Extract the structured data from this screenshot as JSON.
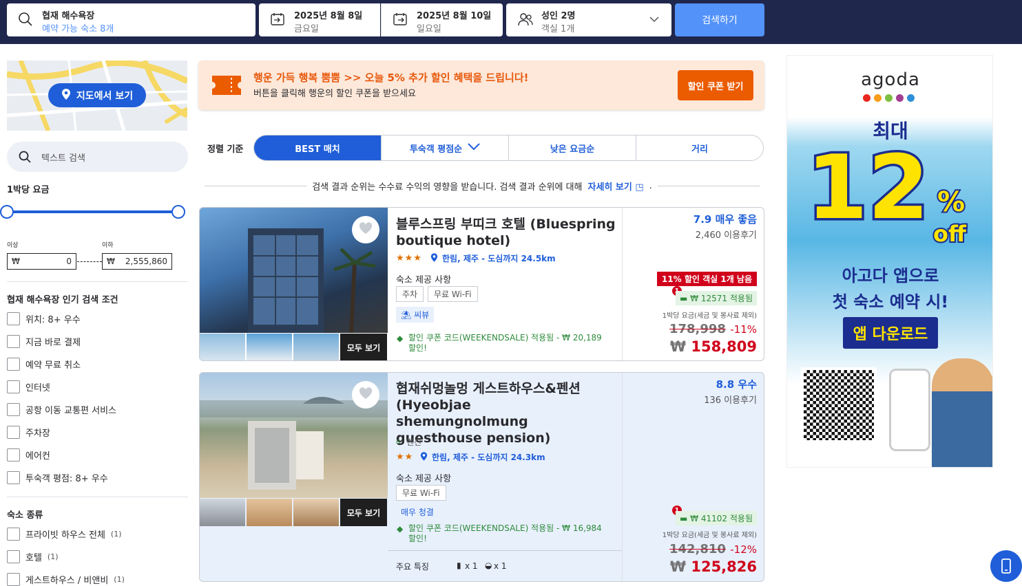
{
  "search": {
    "destination": "협재 해수욕장",
    "destination_sub": "예약 가능 숙소 8개",
    "checkin_date": "2025년 8월 8일",
    "checkin_day": "금요일",
    "checkout_date": "2025년 8월 10일",
    "checkout_day": "일요일",
    "guests": "성인 2명",
    "rooms": "객실 1개",
    "button": "검색하기"
  },
  "sidebar": {
    "map_button": "지도에서 보기",
    "text_search_placeholder": "텍스트 검색",
    "price_title": "1박당 요금",
    "min_label": "이상",
    "max_label": "이하",
    "currency": "₩",
    "min_value": "0",
    "max_value": "2,555,860",
    "popular_title": "협재 해수욕장 인기 검색 조건",
    "popular": [
      "위치: 8+ 우수",
      "지금 바로 결제",
      "예약 무료 취소",
      "인터넷",
      "공항 이동 교통편 서비스",
      "주차장",
      "에어컨",
      "투숙객 평점: 8+ 우수"
    ],
    "type_title": "숙소 종류",
    "types": [
      {
        "label": "프라이빗 하우스 전체",
        "count": "(1)"
      },
      {
        "label": "호텔",
        "count": "(1)"
      },
      {
        "label": "게스트하우스 / 비앤비",
        "count": "(1)"
      }
    ]
  },
  "promo": {
    "title": "행운 가득 행복 뿜뿜 >> 오늘 5% 추가 할인 혜택을 드립니다!",
    "subtitle": "버튼을 클릭해 행운의 할인 쿠폰을 받으세요",
    "button": "할인 쿠폰 받기"
  },
  "sort": {
    "label": "정렬 기준",
    "options": [
      "BEST 매치",
      "투숙객 평점순",
      "낮은 요금순",
      "거리"
    ]
  },
  "disclaimer": {
    "text": "검색 결과 순위는 수수료 수익의 영향을 받습니다. 검색 결과 순위에 대해",
    "link": "자세히 보기",
    "end": "."
  },
  "hotels": [
    {
      "name": "블루스프링 부띠크 호텔 (Bluespring boutique hotel)",
      "stars": "★★★",
      "location": "한림, 제주 - 도심까지 24.5km",
      "amenities_label": "숙소 제공 사항",
      "tags": [
        "주차",
        "무료 Wi-Fi"
      ],
      "feature": "씨뷰",
      "coupon": "할인 쿠폰 코드(WEEKENDSALE) 적용됨 - ₩ 20,189 할인!",
      "see_all": "모두 보기",
      "score": "7.9 매우 좋음",
      "reviews": "2,460 이용후기",
      "deal_badge": "11% 할인 객실 1개 남음",
      "applied": "₩ 12571 적용됨",
      "per_night": "1박당 요금(세금 및 봉사료 제외)",
      "old_price": "178,998",
      "discount": "-11%",
      "currency": "₩",
      "price": "158,809",
      "notif": "1"
    },
    {
      "name": "협재쉬멍놀멍 게스트하우스&펜션 (Hyeobjae shemungnolmung guesthouse pension)",
      "type": "펜션",
      "stars": "★★",
      "location": "한림, 제주 - 도심까지 24.3km",
      "amenities_label": "숙소 제공 사항",
      "tags": [
        "무료 Wi-Fi"
      ],
      "feature": "매우 청결",
      "coupon": "할인 쿠폰 코드(WEEKENDSALE) 적용됨 - ₩ 16,984 할인!",
      "see_all": "모두 보기",
      "key_features": "주요 특징",
      "rooms_count": "x 1",
      "bath_count": "x 1",
      "score": "8.8 우수",
      "reviews": "136 이용후기",
      "applied": "₩ 41102 적용됨",
      "per_night": "1박당 요금(세금 및 봉사료 제외)",
      "old_price": "142,810",
      "discount": "-12%",
      "currency": "₩",
      "price": "125,826",
      "notif": "1"
    }
  ],
  "ad": {
    "brand": "agoda",
    "line1": "최대",
    "big": "12",
    "pct": "%",
    "off": "off",
    "line2": "아고다 앱으로",
    "line3": "첫 숙소 예약 시!",
    "button": "앱 다운로드"
  },
  "colors": {
    "nav": "#20274d",
    "accent": "#1f5ed8",
    "search_btn": "#5392f9",
    "price": "#d0021b",
    "promo": "#eb5b00"
  }
}
